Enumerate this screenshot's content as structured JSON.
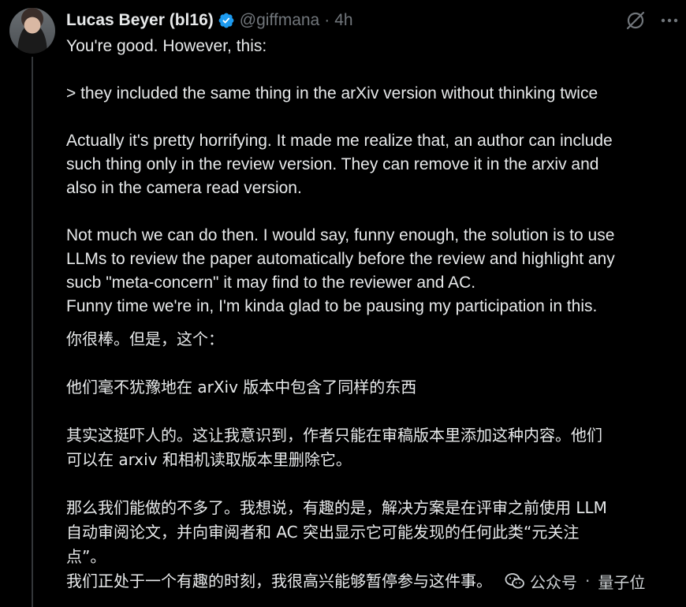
{
  "tweet": {
    "display_name": "Lucas Beyer (bl16)",
    "handle": "@giffmana",
    "separator": "·",
    "time": "4h",
    "english": {
      "line_1": "You're good. However, this:",
      "line_2": "> they included the same thing in the arXiv version without thinking twice",
      "line_3a": "Actually it's pretty horrifying. It made me realize that, an author can include",
      "line_3b": "such thing only in the review version. They can remove it in the arxiv and",
      "line_3c": "also in the camera read version.",
      "line_4a": "Not much we can do then. I would say, funny enough, the solution is to use",
      "line_4b": "LLMs to review the paper automatically before the review and highlight any",
      "line_4c": "sucb \"meta-concern\" it may find to the reviewer and AC.",
      "line_5": "Funny time we're in, I'm kinda glad to be pausing my participation in this."
    },
    "chinese": {
      "line_1": "你很棒。但是，这个：",
      "line_2": "他们毫不犹豫地在 arXiv 版本中包含了同样的东西",
      "line_3a": "其实这挺吓人的。这让我意识到，作者只能在审稿版本里添加这种内容。他们",
      "line_3b": "可以在 arxiv 和相机读取版本里删除它。",
      "line_4a": "那么我们能做的不多了。我想说，有趣的是，解决方案是在评审之前使用 LLM",
      "line_4b": "自动审阅论文，并向审阅者和 AC 突出显示它可能发现的任何此类“元关注",
      "line_4c": "点”。",
      "line_5": "我们正处于一个有趣的时刻，我很高兴能够暂停参与这件事。"
    }
  },
  "watermark": {
    "account": "公众号",
    "separator": "·",
    "name": "量子位"
  },
  "icons": {
    "verified": "verified-badge-icon",
    "grok": "grok-icon",
    "more": "more-options-icon",
    "wechat": "wechat-icon"
  },
  "colors": {
    "background": "#000000",
    "text": "#e7e9ea",
    "secondary": "#71767b",
    "verified": "#1d9bf0"
  }
}
